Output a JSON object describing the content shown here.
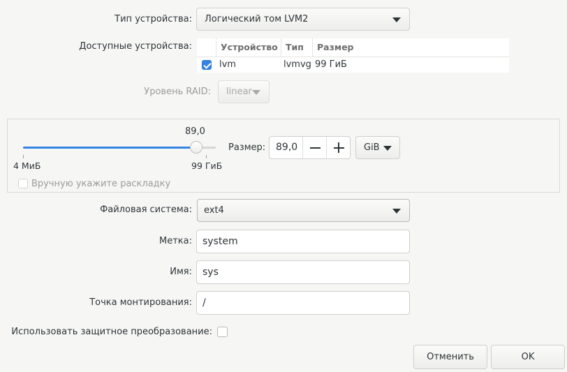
{
  "device_type": {
    "label": "Тип устройства:",
    "value": "Логический том LVM2"
  },
  "available_devices": {
    "label": "Доступные устройства:",
    "columns": [
      "Устройство",
      "Тип",
      "Размер"
    ],
    "rows": [
      {
        "checked": true,
        "device": "lvm",
        "type": "lvmvg",
        "size": "99 ГиБ"
      }
    ]
  },
  "raid": {
    "label": "Уровень RAID:",
    "value": "linear"
  },
  "size_section": {
    "slider_value_label": "89,0",
    "slider_min_label": "4 МиБ",
    "slider_max_label": "99 ГиБ",
    "slider_level_fraction": 0.898,
    "size_label": "Размер:",
    "size_value": "89,0",
    "unit": "GiB",
    "manual_layout_label": "Вручную укажите раскладку",
    "manual_layout_checked": false
  },
  "filesystem": {
    "label": "Файловая система:",
    "value": "ext4"
  },
  "label_field": {
    "label": "Метка:",
    "value": "system"
  },
  "name_field": {
    "label": "Имя:",
    "value": "sys"
  },
  "mount_field": {
    "label": "Точка монтирования:",
    "value": "/"
  },
  "encryption": {
    "label": "Использовать защитное преобразование:",
    "checked": false
  },
  "buttons": {
    "cancel": "Отменить",
    "ok": "OK"
  },
  "colors": {
    "accent": "#3584e4",
    "text": "#2e3436",
    "disabled_text": "#9a9d98"
  }
}
